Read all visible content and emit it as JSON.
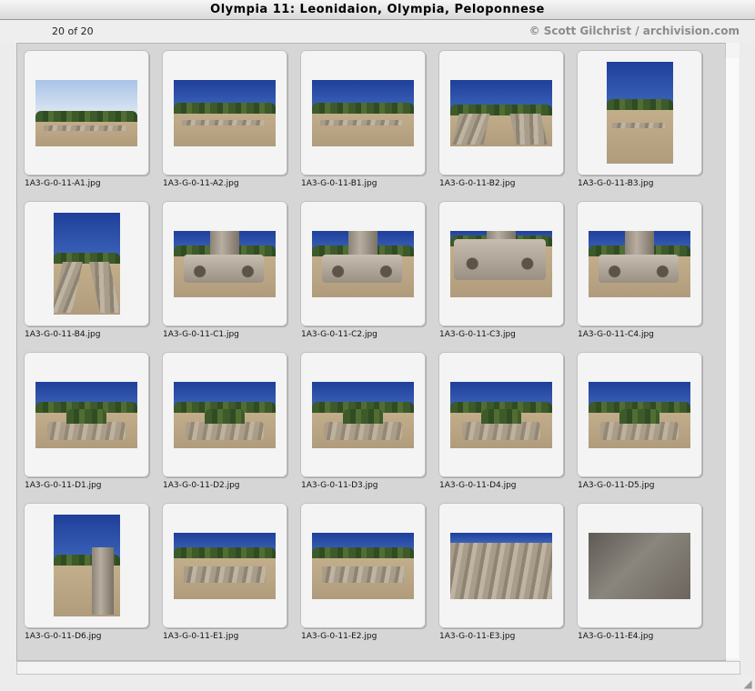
{
  "window": {
    "title": "Olympia 11: Leonidaion, Olympia, Peloponnese"
  },
  "header": {
    "count": "20 of 20",
    "copyright": "© Scott Gilchrist / archivision.com"
  },
  "colors": {
    "sky": "#3b63b8",
    "sky_pale": "#a9c3e6",
    "ground": "#b09c7c",
    "foliage": "#3d5a2a",
    "stone": "#a89c8a"
  },
  "slides": [
    {
      "filename": "1A3-G-0-11-A1.jpg",
      "orientation": "landscape",
      "scene": "pale-sky-field"
    },
    {
      "filename": "1A3-G-0-11-A2.jpg",
      "orientation": "landscape",
      "scene": "ruins-field"
    },
    {
      "filename": "1A3-G-0-11-B1.jpg",
      "orientation": "landscape",
      "scene": "ruins-field"
    },
    {
      "filename": "1A3-G-0-11-B2.jpg",
      "orientation": "landscape",
      "scene": "colonnade-path"
    },
    {
      "filename": "1A3-G-0-11-B3.jpg",
      "orientation": "portrait",
      "scene": "ruins-field"
    },
    {
      "filename": "1A3-G-0-11-B4.jpg",
      "orientation": "portrait",
      "scene": "colonnade-path"
    },
    {
      "filename": "1A3-G-0-11-C1.jpg",
      "orientation": "landscape",
      "scene": "ionic-capital"
    },
    {
      "filename": "1A3-G-0-11-C2.jpg",
      "orientation": "landscape",
      "scene": "ionic-capital"
    },
    {
      "filename": "1A3-G-0-11-C3.jpg",
      "orientation": "landscape",
      "scene": "ionic-capital-close"
    },
    {
      "filename": "1A3-G-0-11-C4.jpg",
      "orientation": "landscape",
      "scene": "ionic-capital"
    },
    {
      "filename": "1A3-G-0-11-D1.jpg",
      "orientation": "landscape",
      "scene": "basin"
    },
    {
      "filename": "1A3-G-0-11-D2.jpg",
      "orientation": "landscape",
      "scene": "basin"
    },
    {
      "filename": "1A3-G-0-11-D3.jpg",
      "orientation": "landscape",
      "scene": "basin"
    },
    {
      "filename": "1A3-G-0-11-D4.jpg",
      "orientation": "landscape",
      "scene": "basin"
    },
    {
      "filename": "1A3-G-0-11-D5.jpg",
      "orientation": "landscape",
      "scene": "basin"
    },
    {
      "filename": "1A3-G-0-11-D6.jpg",
      "orientation": "portrait",
      "scene": "column-drums"
    },
    {
      "filename": "1A3-G-0-11-E1.jpg",
      "orientation": "landscape",
      "scene": "wall-trees"
    },
    {
      "filename": "1A3-G-0-11-E2.jpg",
      "orientation": "landscape",
      "scene": "wall-trees"
    },
    {
      "filename": "1A3-G-0-11-E3.jpg",
      "orientation": "landscape",
      "scene": "stone-rows"
    },
    {
      "filename": "1A3-G-0-11-E4.jpg",
      "orientation": "landscape",
      "scene": "stone-closeup"
    }
  ]
}
